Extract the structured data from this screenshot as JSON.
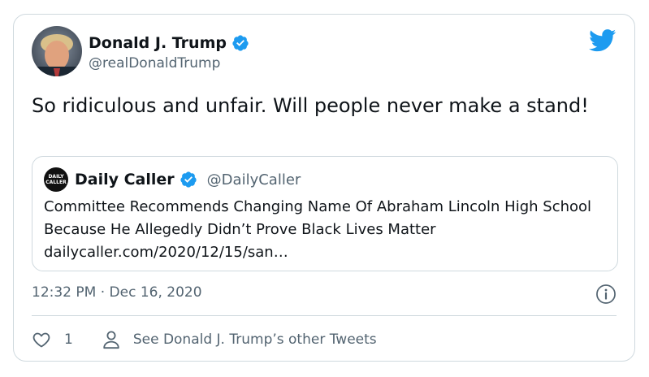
{
  "author": {
    "name": "Donald J. Trump",
    "handle": "@realDonaldTrump",
    "verified": true
  },
  "tweet": {
    "text": "So ridiculous and unfair. Will people never make a stand!"
  },
  "quoted_tweet": {
    "avatar_text_line1": "DAILY",
    "avatar_text_line2": "CALLER",
    "name": "Daily Caller",
    "handle": "@DailyCaller",
    "verified": true,
    "text": "Committee Recommends Changing Name Of Abraham Lincoln High School Because He Allegedly Didn’t Prove Black Lives Matter",
    "link": "dailycaller.com/2020/12/15/san…"
  },
  "meta": {
    "timestamp": "12:32 PM · Dec 16, 2020"
  },
  "actions": {
    "like_count": "1",
    "other_tweets_label": "See Donald J. Trump’s other Tweets"
  },
  "icons": {
    "brand": "twitter-bird-icon",
    "verified": "verified-badge-icon",
    "info": "info-icon",
    "like": "heart-icon",
    "profile": "person-icon"
  },
  "colors": {
    "brand_blue": "#1d9bf0",
    "text_primary": "#0f1419",
    "text_secondary": "#536471",
    "border": "#cfd9de"
  }
}
